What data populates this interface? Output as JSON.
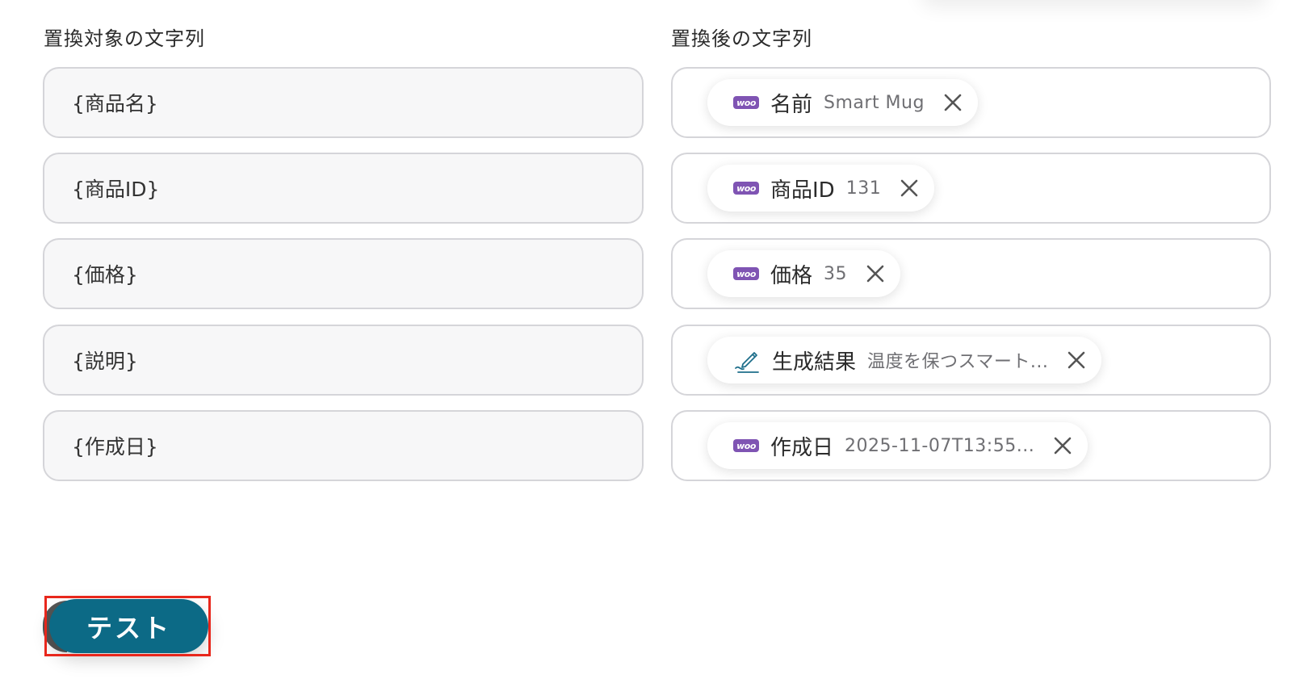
{
  "headers": {
    "target": "置換対象の文字列",
    "replacement": "置換後の文字列"
  },
  "rows": [
    {
      "target": "{商品名}",
      "chip": {
        "icon": "woocommerce-icon",
        "label": "名前",
        "value": "Smart Mug"
      }
    },
    {
      "target": "{商品ID}",
      "chip": {
        "icon": "woocommerce-icon",
        "label": "商品ID",
        "value": "131"
      }
    },
    {
      "target": "{価格}",
      "chip": {
        "icon": "woocommerce-icon",
        "label": "価格",
        "value": "35"
      }
    },
    {
      "target": "{説明}",
      "chip": {
        "icon": "pen-icon",
        "label": "生成結果",
        "value": "温度を保つスマート..."
      }
    },
    {
      "target": "{作成日}",
      "chip": {
        "icon": "woocommerce-icon",
        "label": "作成日",
        "value": "2025-11-07T13:55..."
      }
    }
  ],
  "woo_badge_text": "woo",
  "test_button": {
    "label": "テスト"
  },
  "colors": {
    "button": "#0c6a86",
    "highlight": "#e8271c",
    "woo": "#7f54b3",
    "pen": "#1f6f8b"
  }
}
